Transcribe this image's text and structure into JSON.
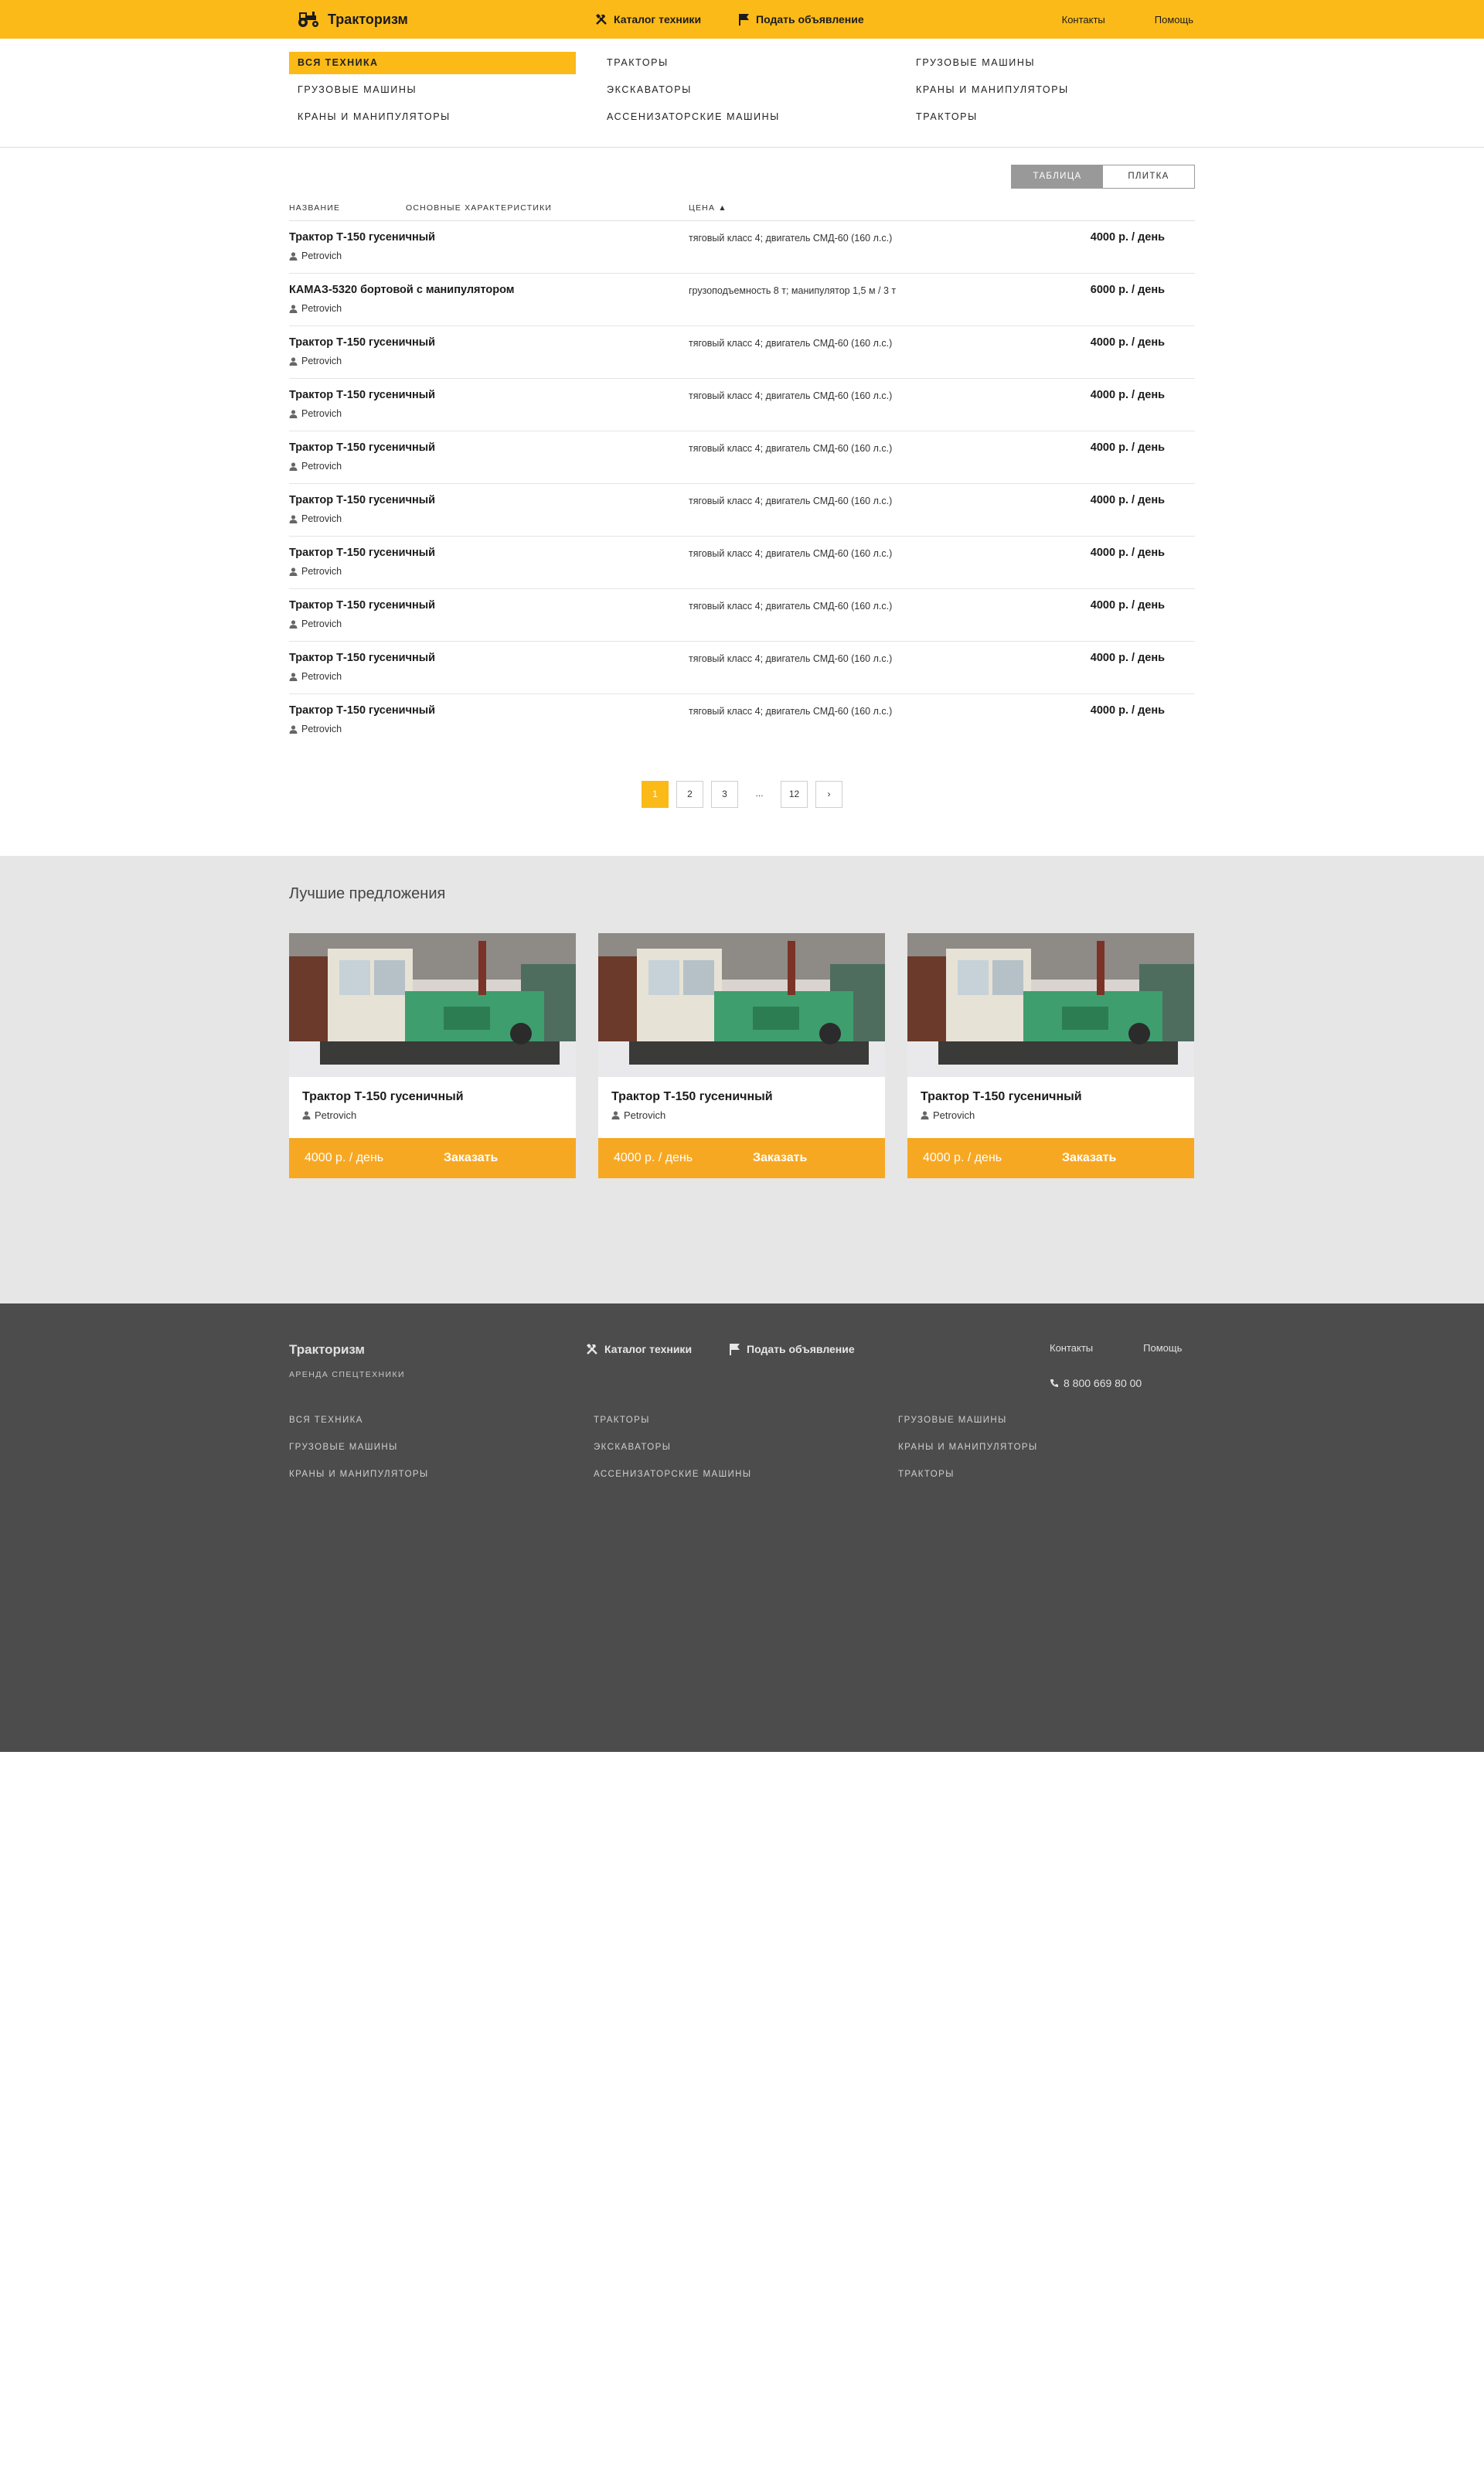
{
  "header": {
    "brand": "Тракторизм",
    "nav": [
      {
        "label": "Каталог техники",
        "icon": "tools-icon"
      },
      {
        "label": "Подать объявление",
        "icon": "flag-icon"
      }
    ],
    "links": [
      "Контакты",
      "Помощь"
    ]
  },
  "categories": {
    "columns": [
      [
        "ВСЯ ТЕХНИКА",
        "ГРУЗОВЫЕ МАШИНЫ",
        "КРАНЫ И МАНИПУЛЯТОРЫ"
      ],
      [
        "ТРАКТОРЫ",
        "ЭКСКАВАТОРЫ",
        "АССЕНИЗАТОРСКИЕ МАШИНЫ"
      ],
      [
        "ГРУЗОВЫЕ МАШИНЫ",
        "КРАНЫ И МАНИПУЛЯТОРЫ",
        "ТРАКТОРЫ"
      ]
    ],
    "active": "ВСЯ ТЕХНИКА"
  },
  "view_toggle": {
    "table": "ТАБЛИЦА",
    "tiles": "ПЛИТКА",
    "selected": "ТАБЛИЦА"
  },
  "table": {
    "headers": {
      "name": "НАЗВАНИЕ",
      "char": "ОСНОВНЫЕ ХАРАКТЕРИСТИКИ",
      "price": "ЦЕНА ▲"
    },
    "rows": [
      {
        "title": "Трактор Т-150 гусеничный",
        "user": "Petrovich",
        "specs": "тяговый класс 4; двигатель СМД-60 (160 л.с.)",
        "price": "4000 р. / день"
      },
      {
        "title": "КАМАЗ-5320 бортовой с манипулятором",
        "user": "Petrovich",
        "specs": "грузоподъемность 8 т; манипулятор 1,5 м / 3 т",
        "price": "6000 р. / день"
      },
      {
        "title": "Трактор Т-150 гусеничный",
        "user": "Petrovich",
        "specs": "тяговый класс 4; двигатель СМД-60 (160 л.с.)",
        "price": "4000 р. / день"
      },
      {
        "title": "Трактор Т-150 гусеничный",
        "user": "Petrovich",
        "specs": "тяговый класс 4; двигатель СМД-60 (160 л.с.)",
        "price": "4000 р. / день"
      },
      {
        "title": "Трактор Т-150 гусеничный",
        "user": "Petrovich",
        "specs": "тяговый класс 4; двигатель СМД-60 (160 л.с.)",
        "price": "4000 р. / день"
      },
      {
        "title": "Трактор Т-150 гусеничный",
        "user": "Petrovich",
        "specs": "тяговый класс 4; двигатель СМД-60 (160 л.с.)",
        "price": "4000 р. / день"
      },
      {
        "title": "Трактор Т-150 гусеничный",
        "user": "Petrovich",
        "specs": "тяговый класс 4; двигатель СМД-60 (160 л.с.)",
        "price": "4000 р. / день"
      },
      {
        "title": "Трактор Т-150 гусеничный",
        "user": "Petrovich",
        "specs": "тяговый класс 4; двигатель СМД-60 (160 л.с.)",
        "price": "4000 р. / день"
      },
      {
        "title": "Трактор Т-150 гусеничный",
        "user": "Petrovich",
        "specs": "тяговый класс 4; двигатель СМД-60 (160 л.с.)",
        "price": "4000 р. / день"
      },
      {
        "title": "Трактор Т-150 гусеничный",
        "user": "Petrovich",
        "specs": "тяговый класс 4; двигатель СМД-60 (160 л.с.)",
        "price": "4000 р. / день"
      }
    ]
  },
  "pagination": {
    "pages": [
      "1",
      "2",
      "3",
      "...",
      "12"
    ],
    "current": "1",
    "next": "›"
  },
  "best_offers": {
    "title": "Лучшие предложения",
    "cards": [
      {
        "title": "Трактор Т-150 гусеничный",
        "user": "Petrovich",
        "price": "4000 р. / день",
        "action": "Заказать"
      },
      {
        "title": "Трактор Т-150 гусеничный",
        "user": "Petrovich",
        "price": "4000 р. / день",
        "action": "Заказать"
      },
      {
        "title": "Трактор Т-150 гусеничный",
        "user": "Petrovich",
        "price": "4000 р. / день",
        "action": "Заказать"
      }
    ]
  },
  "footer": {
    "brand": "Тракторизм",
    "tagline": "АРЕНДА СПЕЦТЕХНИКИ",
    "nav": [
      "Каталог техники",
      "Подать объявление"
    ],
    "links": [
      "Контакты",
      "Помощь"
    ],
    "phone": "8 800 669 80 00",
    "categories": [
      [
        "ВСЯ ТЕХНИКА",
        "ГРУЗОВЫЕ МАШИНЫ",
        "КРАНЫ И МАНИПУЛЯТОРЫ"
      ],
      [
        "ТРАКТОРЫ",
        "ЭКСКАВАТОРЫ",
        "АССЕНИЗАТОРСКИЕ МАШИНЫ"
      ],
      [
        "ГРУЗОВЫЕ МАШИНЫ",
        "КРАНЫ И МАНИПУЛЯТОРЫ",
        "ТРАКТОРЫ"
      ]
    ]
  },
  "colors": {
    "accent": "#fbba18",
    "order_bar": "#f7a823",
    "footer_bg": "#4c4c4c",
    "section_bg": "#e6e6e6"
  }
}
